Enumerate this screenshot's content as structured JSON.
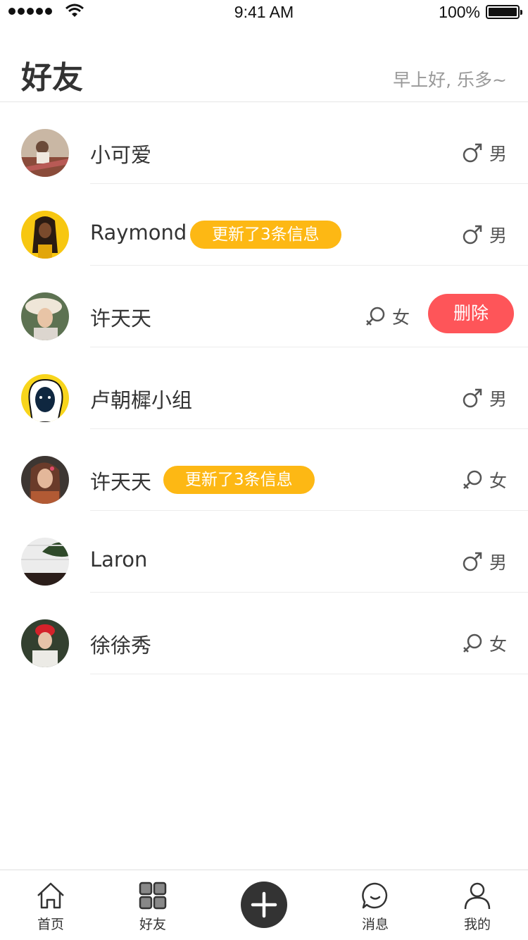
{
  "status_bar": {
    "time": "9:41 AM",
    "battery": "100%"
  },
  "header": {
    "title": "好友",
    "greeting": "早上好, 乐多~"
  },
  "friends": [
    {
      "name": "小可爱",
      "gender": "男",
      "gender_icon": "male-icon",
      "badge": ""
    },
    {
      "name": "Raymond",
      "gender": "男",
      "gender_icon": "male-icon",
      "badge": "更新了3条信息"
    },
    {
      "name": "许天天",
      "gender": "女",
      "gender_icon": "female-icon",
      "badge": "",
      "action": "删除"
    },
    {
      "name": "卢朝樨小组",
      "gender": "男",
      "gender_icon": "male-icon",
      "badge": ""
    },
    {
      "name": "许天天",
      "gender": "女",
      "gender_icon": "female-icon",
      "badge": "更新了3条信息"
    },
    {
      "name": "Laron",
      "gender": "男",
      "gender_icon": "male-icon",
      "badge": ""
    },
    {
      "name": "徐徐秀",
      "gender": "女",
      "gender_icon": "female-icon",
      "badge": ""
    }
  ],
  "tab_bar": {
    "items": [
      {
        "label": "首页",
        "icon": "home-icon"
      },
      {
        "label": "好友",
        "icon": "grid-icon"
      },
      {
        "label": "",
        "icon": "plus-icon"
      },
      {
        "label": "消息",
        "icon": "chat-bubble-icon"
      },
      {
        "label": "我的",
        "icon": "user-icon"
      }
    ]
  },
  "colors": {
    "badge": "#fdb814",
    "delete": "#fe5559",
    "add_button": "#333333"
  }
}
